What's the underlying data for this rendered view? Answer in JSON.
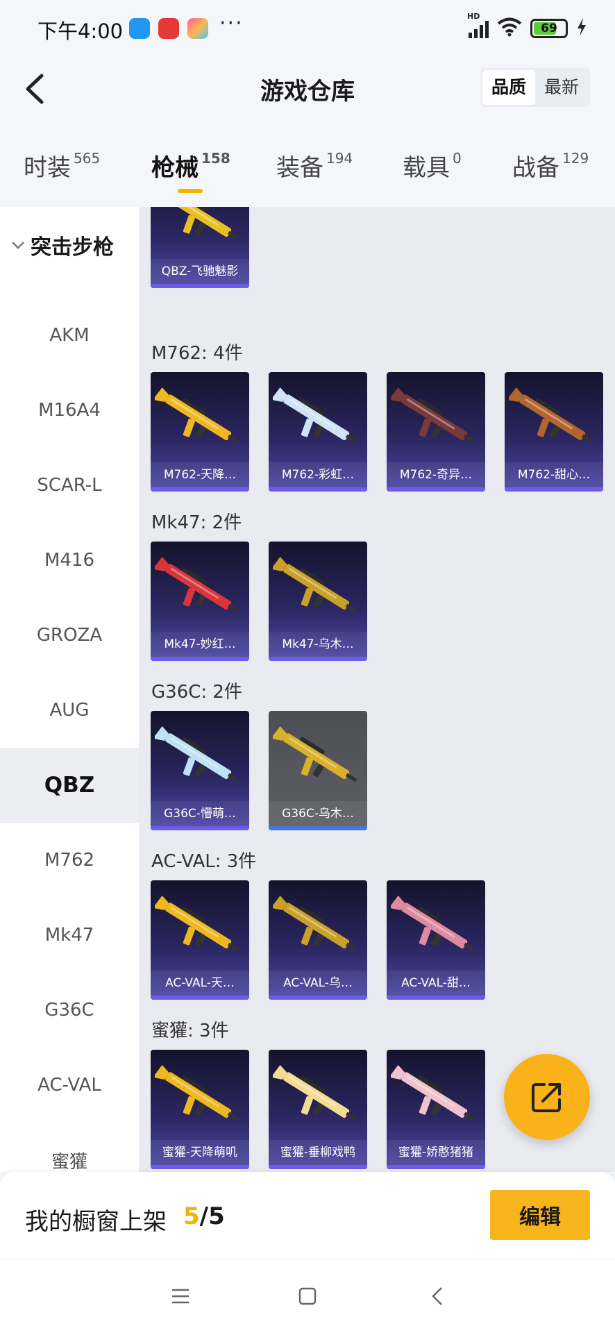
{
  "status_bar": {
    "time": "下午4:00",
    "more": "···",
    "battery": "69",
    "network": "HD"
  },
  "header": {
    "title": "游戏仓库",
    "sort_options": [
      "品质",
      "最新"
    ],
    "active_sort": "品质"
  },
  "tabs": [
    {
      "label": "时装",
      "count": "565"
    },
    {
      "label": "枪械",
      "count": "158"
    },
    {
      "label": "装备",
      "count": "194"
    },
    {
      "label": "载具",
      "count": "0"
    },
    {
      "label": "战备",
      "count": "129"
    }
  ],
  "active_tab": "枪械",
  "sidebar": {
    "group_label": "突击步枪",
    "items": [
      "AKM",
      "M16A4",
      "SCAR-L",
      "M416",
      "GROZA",
      "AUG",
      "QBZ",
      "M762",
      "Mk47",
      "G36C",
      "AC-VAL",
      "蜜獾"
    ],
    "active": "QBZ"
  },
  "sections": [
    {
      "title": "",
      "items": [
        {
          "name": "QBZ-飞驰魅影",
          "color": "#e8c021"
        }
      ]
    },
    {
      "title": "M762: 4件",
      "items": [
        {
          "name": "M762-天降…",
          "color": "#f0b820"
        },
        {
          "name": "M762-彩虹…",
          "color": "#cfe3f5"
        },
        {
          "name": "M762-奇异…",
          "color": "#7a3a3a"
        },
        {
          "name": "M762-甜心…",
          "color": "#b4652f"
        }
      ]
    },
    {
      "title": "Mk47: 2件",
      "items": [
        {
          "name": "Mk47-妙红…",
          "color": "#d8363b"
        },
        {
          "name": "Mk47-乌木…",
          "color": "#c9a02a"
        }
      ]
    },
    {
      "title": "G36C: 2件",
      "items": [
        {
          "name": "G36C-懵萌…",
          "color": "#bfe3f3"
        },
        {
          "name": "G36C-乌木…",
          "color": "#d8b12a",
          "grey": true
        }
      ]
    },
    {
      "title": "AC-VAL: 3件",
      "items": [
        {
          "name": "AC-VAL-天…",
          "color": "#f0b820"
        },
        {
          "name": "AC-VAL-乌…",
          "color": "#c9a02a"
        },
        {
          "name": "AC-VAL-甜…",
          "color": "#e08aa0"
        }
      ]
    },
    {
      "title": "蜜獾: 3件",
      "items": [
        {
          "name": "蜜獾-天降萌叽",
          "color": "#f0b820"
        },
        {
          "name": "蜜獾-垂柳戏鸭",
          "color": "#f4dc95"
        },
        {
          "name": "蜜獾-娇憨猪猪",
          "color": "#f2c2cc"
        }
      ]
    }
  ],
  "bottom_bar": {
    "label": "我的橱窗上架",
    "current": "5",
    "separator": "/",
    "total": "5",
    "edit_label": "编辑"
  },
  "colors": {
    "accent": "#f8b41c",
    "card_bottom": "#4e49a6",
    "card_top": "#15132c"
  }
}
